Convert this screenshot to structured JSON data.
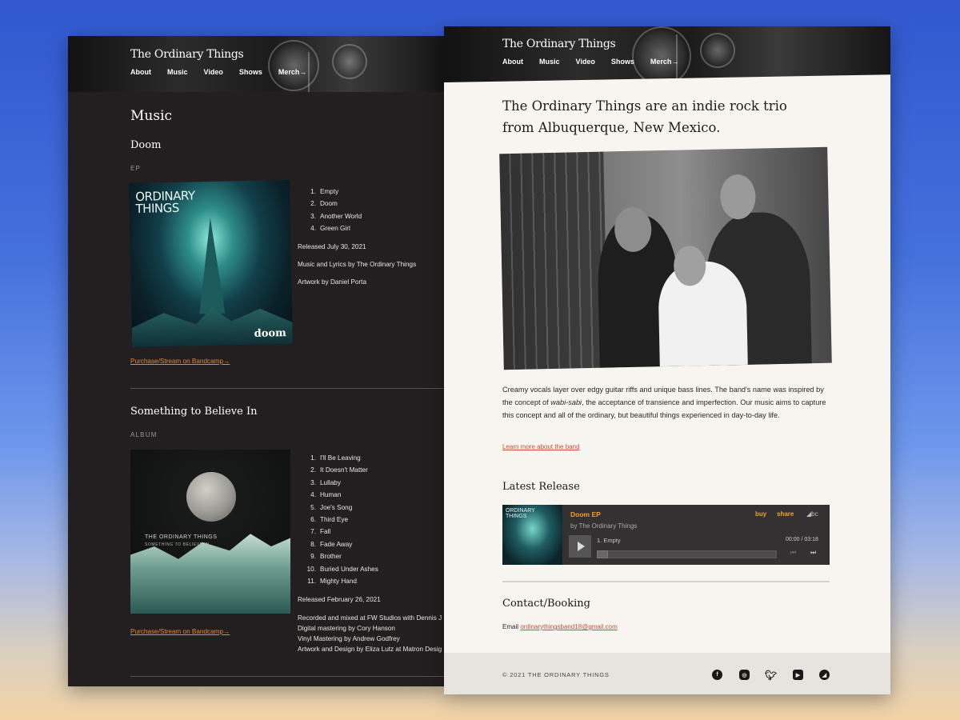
{
  "site": {
    "title": "The Ordinary Things",
    "nav": [
      "About",
      "Music",
      "Video",
      "Shows",
      "Merch→"
    ]
  },
  "music_page": {
    "heading": "Music",
    "releases": [
      {
        "title": "Doom",
        "kind": "EP",
        "cover_title": "ORDINARY THINGS",
        "cover_word": "doom",
        "tracks": [
          {
            "num": "1.",
            "name": "Empty"
          },
          {
            "num": "2.",
            "name": "Doom"
          },
          {
            "num": "3.",
            "name": "Another World"
          },
          {
            "num": "4.",
            "name": "Green Girl"
          }
        ],
        "released": "Released July 30, 2021",
        "credits": [
          "Music and Lyrics by The Ordinary Things",
          "Artwork by Daniel Porta"
        ],
        "link": "Purchase/Stream on Bandcamp→"
      },
      {
        "title": "Something to Believe In",
        "kind": "ALBUM",
        "cover_title": "THE ORDINARY THINGS",
        "cover_sub": "SOMETHING TO BELIEVE IN",
        "tracks": [
          {
            "num": "1.",
            "name": "I'll Be Leaving"
          },
          {
            "num": "2.",
            "name": "It Doesn't Matter"
          },
          {
            "num": "3.",
            "name": "Lullaby"
          },
          {
            "num": "4.",
            "name": "Human"
          },
          {
            "num": "5.",
            "name": "Joe's Song"
          },
          {
            "num": "6.",
            "name": "Third Eye"
          },
          {
            "num": "7.",
            "name": "Fall"
          },
          {
            "num": "8.",
            "name": "Fade Away"
          },
          {
            "num": "9.",
            "name": "Brother"
          },
          {
            "num": "10.",
            "name": "Buried Under Ashes"
          },
          {
            "num": "11.",
            "name": "Mighty Hand"
          }
        ],
        "released": "Released February 26, 2021",
        "credits": [
          "Recorded and mixed at FW Studios with Dennis J",
          "Digital mastering by Cory Hanson",
          "Vinyl Mastering by Andrew Godfrey",
          "Artwork and Design by Eliza Lutz at Matron Desig"
        ],
        "link": "Purchase/Stream on Bandcamp→"
      }
    ]
  },
  "home_page": {
    "intro": "The Ordinary Things are an indie rock trio from Albuquerque, New Mexico.",
    "body_before": "Creamy vocals layer over edgy guitar riffs and unique bass lines. The band's name was inspired by the concept of ",
    "body_em": "wabi-sabi",
    "body_after": ", the acceptance of transience and imperfection. Our music aims to capture this concept and all of the ordinary, but beautiful things experienced in day-to-day life.",
    "learn_link": "Learn more about the band",
    "latest_heading": "Latest Release",
    "player": {
      "art_text": "ORDINARY THINGS",
      "title": "Doom EP",
      "by": "by The Ordinary Things",
      "buy": "buy",
      "share": "share",
      "bc": "bc",
      "track": "1.  Empty",
      "time": "00:00 / 03:18",
      "progress": 0
    },
    "contact_heading": "Contact/Booking",
    "email_label": "Email",
    "email": "ordinarythingsband18@gmail.com",
    "footer": {
      "copyright": "© 2021 THE ORDINARY THINGS",
      "social": [
        "facebook-icon",
        "instagram-icon",
        "twitter-icon",
        "youtube-icon",
        "bandcamp-icon"
      ]
    }
  },
  "colors": {
    "accent_orange": "#e58a2e",
    "link_red": "#c44f3a",
    "dark_bg": "#231f20",
    "light_bg": "#f8f5f0"
  }
}
